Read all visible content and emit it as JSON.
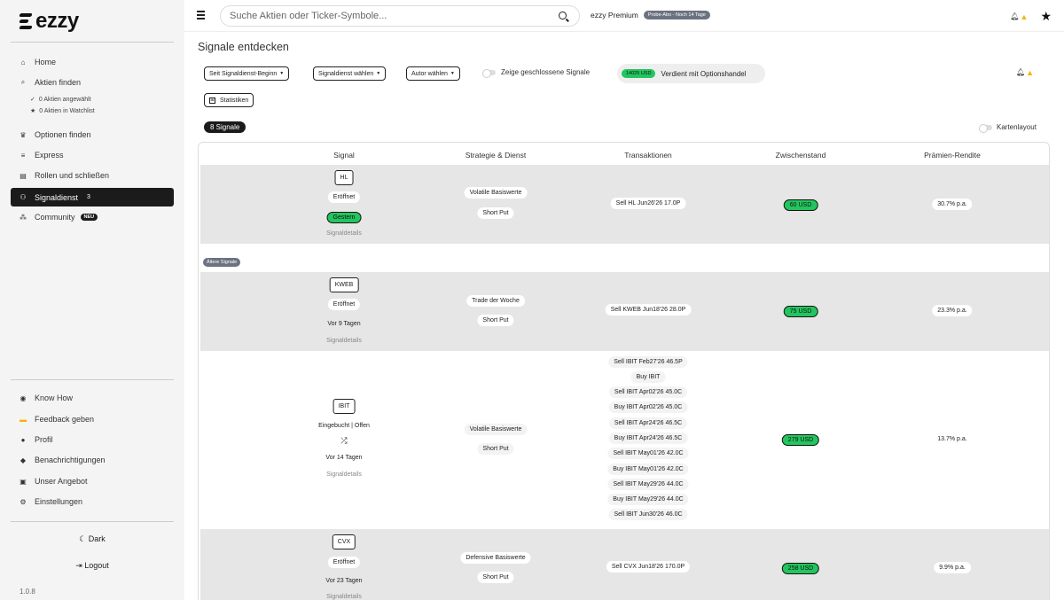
{
  "sidebar": {
    "brand": "ezzy",
    "nav": [
      {
        "label": "Home",
        "icon": "home-icon"
      },
      {
        "label": "Aktien finden",
        "icon": "search-icon"
      },
      {
        "label": "Optionen finden",
        "icon": "trophy-icon"
      },
      {
        "label": "Express",
        "icon": "stack-icon"
      },
      {
        "label": "Rollen und schließen",
        "icon": "bin-icon"
      },
      {
        "label": "Signaldienst",
        "icon": "signal-icon",
        "badge": "3"
      },
      {
        "label": "Community",
        "icon": "group-icon",
        "badge": "NEU"
      }
    ],
    "sub": [
      "0 Aktien angewählt",
      "0 Aktien in Watchlist"
    ],
    "bottom_nav": [
      {
        "label": "Know How",
        "icon": "eye-icon"
      },
      {
        "label": "Feedback geben",
        "icon": "feedback-icon"
      },
      {
        "label": "Profil",
        "icon": "user-icon"
      },
      {
        "label": "Benachrichtigungen",
        "icon": "bell-icon"
      },
      {
        "label": "Unser Angebot",
        "icon": "gift-icon"
      },
      {
        "label": "Einstellungen",
        "icon": "settings-icon"
      }
    ],
    "dark_label": "Dark",
    "logout_label": "Logout",
    "version": "1.0.8"
  },
  "topbar": {
    "search_placeholder": "Suche Aktien oder Ticker-Symbole...",
    "premium_label": "ezzy Premium",
    "trial_badge": "Probe-Abo - Noch 14 Tage"
  },
  "main": {
    "title": "Signale entdecken",
    "filters": [
      "Seit Signaldienst-Beginn",
      "Signaldienst wählen",
      "Autor wählen"
    ],
    "closed_toggle_label": "Zeige geschlossene Signale",
    "earned_amount": "14025 USD",
    "earned_label": "Verdient mit Optionshandel",
    "stats_label": "Statistiken",
    "count_label": "8 Signale",
    "card_layout_label": "Kartenlayout",
    "older_signals_label": "Ältere Signale"
  },
  "table": {
    "headers": [
      "Signal",
      "Strategie & Dienst",
      "Transaktionen",
      "Zwischenstand",
      "Prämien-Rendite"
    ],
    "rows": [
      {
        "ticker": "HL",
        "status": "Eröffnet",
        "time": "Gestern",
        "details": "Signaldetails",
        "strategy": "Volatile Basiswerte",
        "type": "Short Put",
        "transactions": [
          "Sell HL Jun26'26 17.0P"
        ],
        "interim": "60 USD",
        "yield": "30.7% p.a."
      },
      {
        "ticker": "KWEB",
        "status": "Eröffnet",
        "time": "Vor 9 Tagen",
        "details": "Signaldetails",
        "strategy": "Trade der Woche",
        "type": "Short Put",
        "transactions": [
          "Sell KWEB Jun18'26 28.0P"
        ],
        "interim": "75 USD",
        "yield": "23.3% p.a."
      },
      {
        "ticker": "IBIT",
        "status": "Eingebucht | Offen",
        "time": "Vor 14 Tagen",
        "details": "Signaldetails",
        "strategy": "Volatile Basiswerte",
        "type": "Short Put",
        "transactions": [
          "Sell IBIT Feb27'26 46.5P",
          "Buy IBIT",
          "Sell IBIT Apr02'26 45.0C",
          "Buy IBIT Apr02'26 45.0C",
          "Sell IBIT Apr24'26 46.5C",
          "Buy IBIT Apr24'26 46.5C",
          "Sell IBIT May01'26 42.0C",
          "Buy IBIT May01'26 42.0C",
          "Sell IBIT May29'26 44.0C",
          "Buy IBIT May29'26 44.0C",
          "Sell IBIT Jun30'26 46.0C"
        ],
        "interim": "279 USD",
        "yield": "13.7% p.a."
      },
      {
        "ticker": "CVX",
        "status": "Eröffnet",
        "time": "Vor 23 Tagen",
        "details": "Signaldetails",
        "strategy": "Defensive Basiswerte",
        "type": "Short Put",
        "transactions": [
          "Sell CVX Jun18'26 170.0P"
        ],
        "interim": "258 USD",
        "yield": "9.9% p.a."
      }
    ]
  }
}
